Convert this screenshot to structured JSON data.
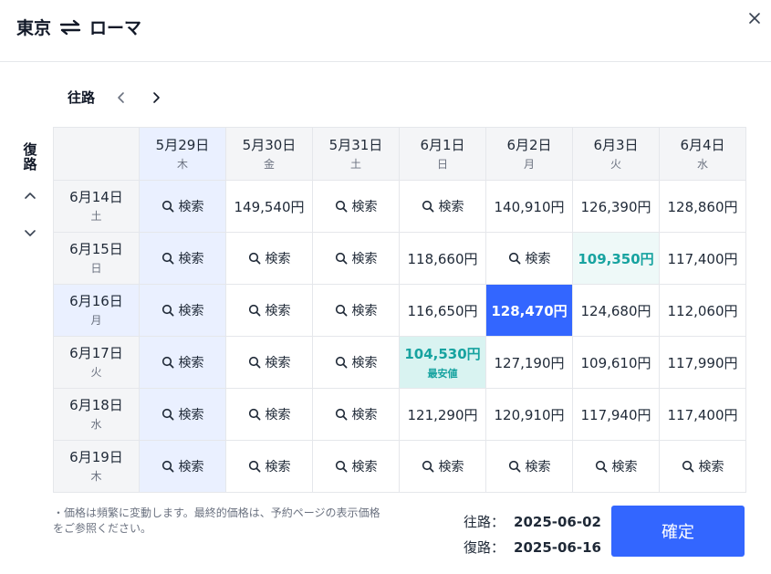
{
  "header": {
    "origin": "東京",
    "destination": "ローマ"
  },
  "outbound_nav": {
    "label": "往路"
  },
  "return_axis": {
    "label": "復路"
  },
  "columns": [
    {
      "date": "5月29日",
      "dow": "木"
    },
    {
      "date": "5月30日",
      "dow": "金"
    },
    {
      "date": "5月31日",
      "dow": "土"
    },
    {
      "date": "6月1日",
      "dow": "日"
    },
    {
      "date": "6月2日",
      "dow": "月"
    },
    {
      "date": "6月3日",
      "dow": "火"
    },
    {
      "date": "6月4日",
      "dow": "水"
    }
  ],
  "rows": [
    {
      "date": "6月14日",
      "dow": "土",
      "cells": [
        "検索",
        "149,540円",
        "検索",
        "検索",
        "140,910円",
        "126,390円",
        "128,860円"
      ]
    },
    {
      "date": "6月15日",
      "dow": "日",
      "cells": [
        "検索",
        "検索",
        "検索",
        "118,660円",
        "検索",
        "109,350円",
        "117,400円"
      ]
    },
    {
      "date": "6月16日",
      "dow": "月",
      "cells": [
        "検索",
        "検索",
        "検索",
        "116,650円",
        "128,470円",
        "124,680円",
        "112,060円"
      ]
    },
    {
      "date": "6月17日",
      "dow": "火",
      "cells": [
        "検索",
        "検索",
        "検索",
        "104,530円",
        "127,190円",
        "109,610円",
        "117,990円"
      ]
    },
    {
      "date": "6月18日",
      "dow": "水",
      "cells": [
        "検索",
        "検索",
        "検索",
        "121,290円",
        "120,910円",
        "117,940円",
        "117,400円"
      ]
    },
    {
      "date": "6月19日",
      "dow": "木",
      "cells": [
        "検索",
        "検索",
        "検索",
        "検索",
        "検索",
        "検索",
        "検索"
      ]
    }
  ],
  "lowest_label": "最安値",
  "note": "・価格は頻繁に変動します。最終的価格は、予約ページの表示価格をご参照ください。",
  "summary": {
    "outbound_label": "往路：",
    "outbound_value": "2025-06-02",
    "return_label": "復路：",
    "return_value": "2025-06-16"
  },
  "confirm_label": "確定",
  "colors": {
    "accent": "#3366ff",
    "lowest_bg": "#d9f3f1",
    "lowest_text": "#17a3a0",
    "highlight_col": "#eaf0ff"
  }
}
